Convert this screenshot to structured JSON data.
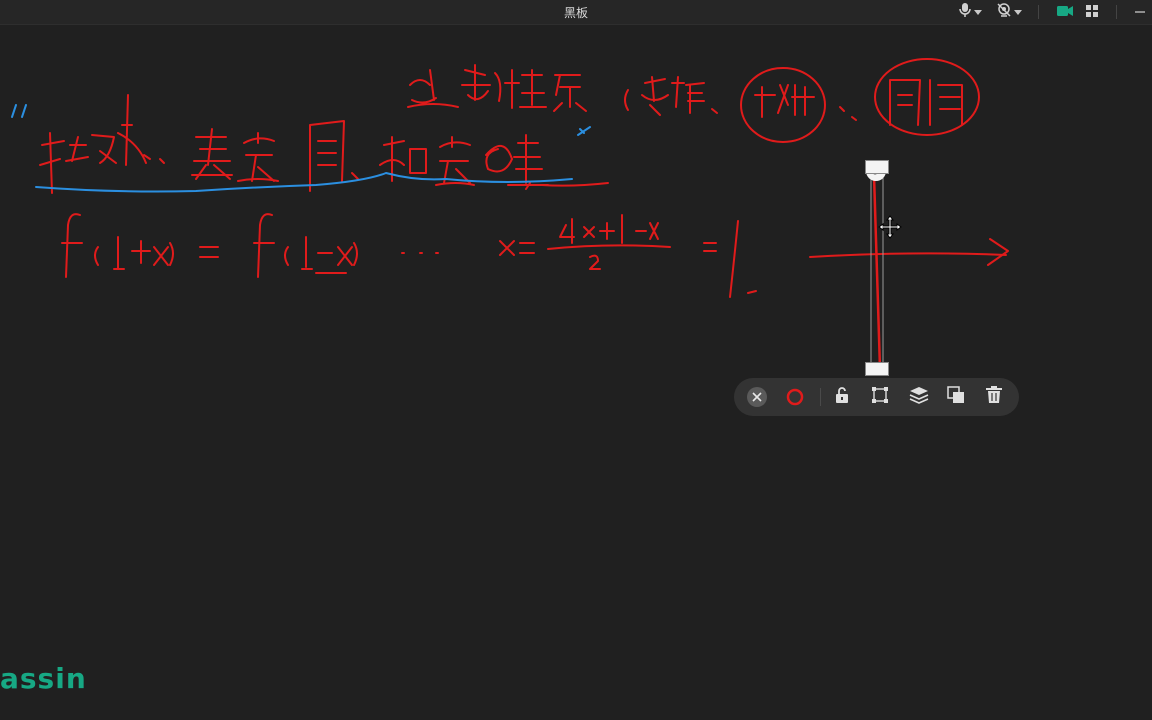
{
  "window": {
    "title": "黑板"
  },
  "titlebar": {
    "icons": [
      "microphone-icon",
      "camera-off-icon",
      "video-camera-icon",
      "grid-apps-icon",
      "minimize-icon"
    ],
    "colors": {
      "accent": "#17a884"
    }
  },
  "board": {
    "ink_colors": {
      "red": "#e01b1b",
      "blue": "#2b8fe0"
    },
    "selected_shape": "vertical-line"
  },
  "selection_toolbar": {
    "tools": [
      "close-icon",
      "stroke-color-icon",
      "unlock-icon",
      "transform-icon",
      "layers-icon",
      "duplicate-icon",
      "delete-icon"
    ],
    "current_color": "#e01b1b"
  },
  "brand": {
    "text": "assin"
  }
}
